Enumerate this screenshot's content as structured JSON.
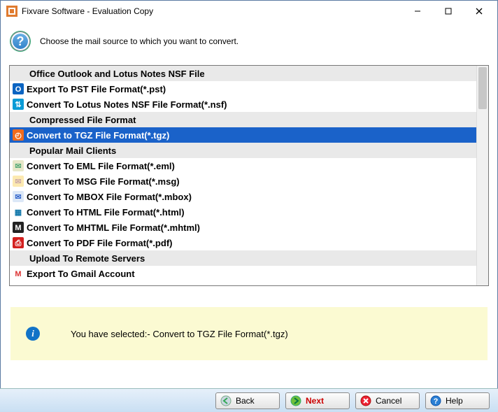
{
  "window": {
    "title": "Fixvare Software - Evaluation Copy"
  },
  "header": {
    "instruction": "Choose the mail source to which you want to convert."
  },
  "groups": [
    {
      "type": "header",
      "label": "Office Outlook and Lotus Notes NSF File"
    },
    {
      "type": "item",
      "icon": "outlook",
      "label": "Export To PST File Format(*.pst)"
    },
    {
      "type": "item",
      "icon": "notes",
      "label": "Convert To Lotus Notes NSF File Format(*.nsf)"
    },
    {
      "type": "header",
      "label": "Compressed File Format"
    },
    {
      "type": "item",
      "icon": "tgz",
      "label": "Convert to TGZ File Format(*.tgz)",
      "selected": true
    },
    {
      "type": "header",
      "label": "Popular Mail Clients"
    },
    {
      "type": "item",
      "icon": "eml",
      "label": "Convert To EML File Format(*.eml)"
    },
    {
      "type": "item",
      "icon": "msg",
      "label": "Convert To MSG File Format(*.msg)"
    },
    {
      "type": "item",
      "icon": "mbox",
      "label": "Convert To MBOX File Format(*.mbox)"
    },
    {
      "type": "item",
      "icon": "html",
      "label": "Convert To HTML File Format(*.html)"
    },
    {
      "type": "item",
      "icon": "mhtml",
      "label": "Convert To MHTML File Format(*.mhtml)"
    },
    {
      "type": "item",
      "icon": "pdf",
      "label": "Convert To PDF File Format(*.pdf)"
    },
    {
      "type": "header",
      "label": "Upload To Remote Servers"
    },
    {
      "type": "item",
      "icon": "gmail",
      "label": "Export To Gmail Account"
    }
  ],
  "banner": {
    "message": "You have selected:- Convert to TGZ File Format(*.tgz)"
  },
  "footer": {
    "back": "Back",
    "next": "Next",
    "cancel": "Cancel",
    "help": "Help"
  },
  "icons": {
    "outlook": {
      "bg": "#0a64c2",
      "fg": "#fff",
      "glyph": "O"
    },
    "notes": {
      "bg": "#0a9bd6",
      "fg": "#fff",
      "glyph": "⇅"
    },
    "tgz": {
      "bg": "#f26b1d",
      "fg": "#fff",
      "glyph": "◴"
    },
    "eml": {
      "bg": "#e7e7c8",
      "fg": "#5a7",
      "glyph": "✉"
    },
    "msg": {
      "bg": "#fce9b0",
      "fg": "#caa",
      "glyph": "✉"
    },
    "mbox": {
      "bg": "#dce8f7",
      "fg": "#36c",
      "glyph": "✉"
    },
    "html": {
      "bg": "#fff",
      "fg": "#17a",
      "glyph": "▦"
    },
    "mhtml": {
      "bg": "#222",
      "fg": "#fff",
      "glyph": "M"
    },
    "pdf": {
      "bg": "#d3201f",
      "fg": "#fff",
      "glyph": "⎙"
    },
    "gmail": {
      "bg": "#fff",
      "fg": "#d33",
      "glyph": "M"
    }
  }
}
